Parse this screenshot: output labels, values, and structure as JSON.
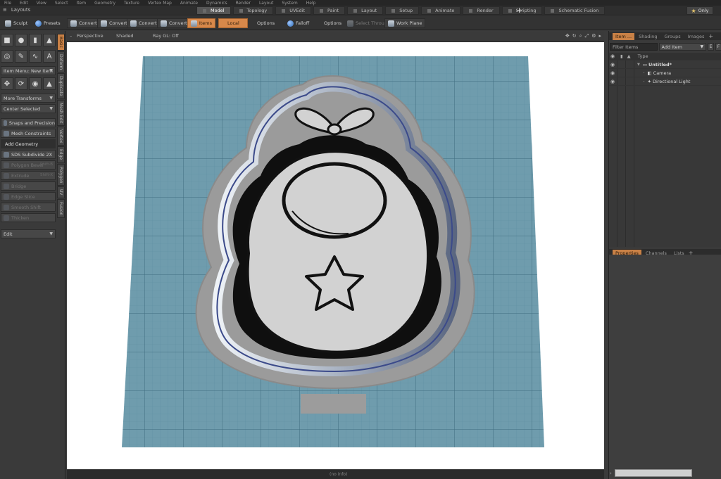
{
  "menubar": [
    "File",
    "Edit",
    "View",
    "Select",
    "Item",
    "Geometry",
    "Texture",
    "Vertex Map",
    "Animate",
    "Dynamics",
    "Render",
    "Layout",
    "System",
    "Help"
  ],
  "layouts_label": "Layouts",
  "layout_tabs": [
    {
      "label": "Model",
      "active": true
    },
    {
      "label": "Topology",
      "active": false
    },
    {
      "label": "UVEdit",
      "active": false
    },
    {
      "label": "Paint",
      "active": false
    },
    {
      "label": "Layout",
      "active": false
    },
    {
      "label": "Setup",
      "active": false
    },
    {
      "label": "Animate",
      "active": false
    },
    {
      "label": "Render",
      "active": false
    },
    {
      "label": "Scripting",
      "active": false
    },
    {
      "label": "Schematic Fusion",
      "active": false
    }
  ],
  "tab_add": "+",
  "only_label": "Only",
  "toolbar": {
    "sculpt": "Sculpt",
    "presets": "Presets",
    "convert1": "Convert",
    "convert2": "Convert",
    "convert3": "Convert",
    "convert4": "Convert",
    "items": "Items",
    "local": "Local",
    "options1": "Options",
    "falloff": "Falloff",
    "options2": "Options",
    "select_through": "Select Through",
    "work_plane": "Work Plane"
  },
  "left_panel": {
    "item_menu": "Item Menu: New Item",
    "more_transforms": "More Transforms",
    "center_selected": "Center Selected",
    "snaps_precision": "Snaps and Precision",
    "mesh_constraints": "Mesh Constraints",
    "add_geometry": "Add Geometry",
    "tools": [
      {
        "label": "SDS Subdivide 2X",
        "shortcut": "",
        "enabled": true
      },
      {
        "label": "Polygon Bevel",
        "shortcut": "Shift-B",
        "enabled": false
      },
      {
        "label": "Extrude",
        "shortcut": "Shift-X",
        "enabled": false
      },
      {
        "label": "Bridge",
        "shortcut": "",
        "enabled": false
      },
      {
        "label": "Edge Slice",
        "shortcut": "",
        "enabled": false
      },
      {
        "label": "Smooth Shift",
        "shortcut": "",
        "enabled": false
      },
      {
        "label": "Thicken",
        "shortcut": "",
        "enabled": false
      }
    ],
    "edit_dropdown": "Edit",
    "vertical_tabs": [
      {
        "label": "Basic",
        "active": true
      },
      {
        "label": "Deform",
        "active": false
      },
      {
        "label": "Duplicate",
        "active": false
      },
      {
        "label": "Mesh Edit",
        "active": false
      },
      {
        "label": "Vertex",
        "active": false
      },
      {
        "label": "Edge",
        "active": false
      },
      {
        "label": "Polygon",
        "active": false
      },
      {
        "label": "UV",
        "active": false
      },
      {
        "label": "Fusion",
        "active": false
      }
    ]
  },
  "viewport": {
    "view": "Perspective",
    "shading": "Shaded",
    "ray_gl": "Ray GL: Off",
    "footer": "(no info)",
    "colors": {
      "grid_bg": "#6f9cad",
      "grid_line": "#4d7d90",
      "major_line": "#3a6678",
      "cutter": "#9a9a9a",
      "blade": "#3b4a8a",
      "bib_fill": "#d2d2d2",
      "outline": "#111111"
    }
  },
  "right_panel": {
    "top_tabs": [
      {
        "label": "Item ...",
        "active": true
      },
      {
        "label": "Shading",
        "active": false
      },
      {
        "label": "Groups",
        "active": false
      },
      {
        "label": "Images",
        "active": false
      }
    ],
    "filter_placeholder": "Filter Items",
    "add_item": "Add Item",
    "header_type": "Type",
    "items": [
      {
        "name": "Untitled*",
        "level": 0,
        "icon": "scene-icon"
      },
      {
        "name": "Camera",
        "level": 1,
        "icon": "camera-icon"
      },
      {
        "name": "Directional Light",
        "level": 1,
        "icon": "light-icon"
      }
    ],
    "bottom_tabs": [
      {
        "label": "Properties",
        "active": true
      },
      {
        "label": "Channels",
        "active": false
      },
      {
        "label": "Lists",
        "active": false
      }
    ]
  }
}
